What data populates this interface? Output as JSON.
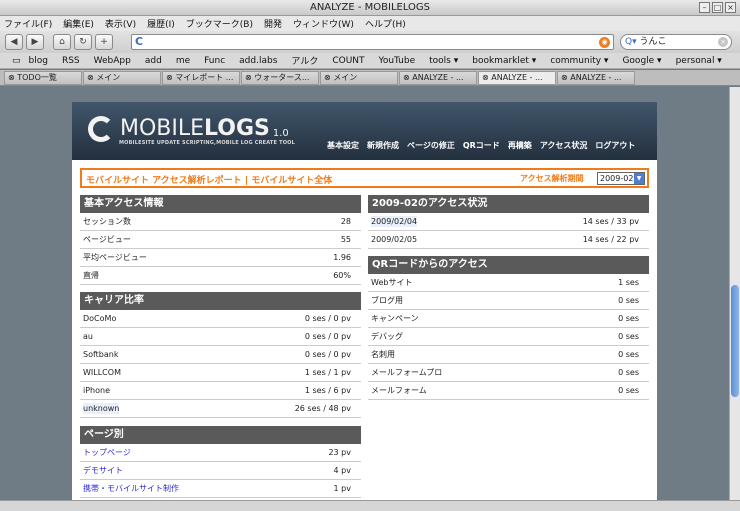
{
  "window": {
    "title": "ANALYZE - MOBILELOGS"
  },
  "menu": [
    "ファイル(F)",
    "編集(E)",
    "表示(V)",
    "履歴(I)",
    "ブックマーク(B)",
    "開発",
    "ウィンドウ(W)",
    "ヘルプ(H)"
  ],
  "search": {
    "value": "うんこ"
  },
  "bookmarks": [
    "blog",
    "RSS",
    "WebApp",
    "add",
    "me",
    "Func",
    "add.labs",
    "アルク",
    "COUNT",
    "YouTube",
    "tools ▾",
    "bookmarklet ▾",
    "community ▾",
    "Google ▾",
    "personal ▾"
  ],
  "tabs": [
    "TODO一覧",
    "メイン",
    "マイレポート ...",
    "ウォータース...",
    "メイン",
    "ANALYZE - ...",
    "ANALYZE - ...",
    "ANALYZE - ..."
  ],
  "site": {
    "logo_main": "MOBILE",
    "logo_bold": "LOGS",
    "logo_version": "1.0",
    "logo_sub": "MOBILESITE UPDATE SCRIPTING,MOBILE LOG CREATE TOOL",
    "nav": [
      "基本設定",
      "新規作成",
      "ページの修正",
      "QRコード",
      "再構築",
      "アクセス状況",
      "ログアウト"
    ]
  },
  "report": {
    "title": "モバイルサイト アクセス解析レポート | モバイルサイト全体",
    "period_label": "アクセス解析期間",
    "period_value": "2009-02"
  },
  "basic": {
    "heading": "基本アクセス情報",
    "rows": [
      {
        "label": "セッション数",
        "value": "28"
      },
      {
        "label": "ページビュー",
        "value": "55"
      },
      {
        "label": "平均ページビュー",
        "value": "1.96"
      },
      {
        "label": "直帰",
        "value": "60%"
      }
    ]
  },
  "carrier": {
    "heading": "キャリア比率",
    "rows": [
      {
        "label": "DoCoMo",
        "value": "0 ses / 0 pv"
      },
      {
        "label": "au",
        "value": "0 ses / 0 pv"
      },
      {
        "label": "Softbank",
        "value": "0 ses / 0 pv"
      },
      {
        "label": "WILLCOM",
        "value": "1 ses / 1 pv"
      },
      {
        "label": "iPhone",
        "value": "1 ses / 6 pv"
      },
      {
        "label": "unknown",
        "value": "26 ses / 48 pv"
      }
    ]
  },
  "pages": {
    "heading": "ページ別",
    "rows": [
      {
        "label": "トップページ",
        "value": "23 pv"
      },
      {
        "label": "デモサイト",
        "value": "4 pv"
      },
      {
        "label": "携帯・モバイルサイト制作",
        "value": "1 pv"
      }
    ]
  },
  "monthly": {
    "heading": "2009-02のアクセス状況",
    "rows": [
      {
        "label": "2009/02/04",
        "value": "14 ses / 33 pv"
      },
      {
        "label": "2009/02/05",
        "value": "14 ses / 22 pv"
      }
    ]
  },
  "qr": {
    "heading": "QRコードからのアクセス",
    "rows": [
      {
        "label": "Webサイト",
        "value": "1 ses"
      },
      {
        "label": "ブログ用",
        "value": "0 ses"
      },
      {
        "label": "キャンペーン",
        "value": "0 ses"
      },
      {
        "label": "デバッグ",
        "value": "0 ses"
      },
      {
        "label": "名刺用",
        "value": "0 ses"
      },
      {
        "label": "メールフォームプロ",
        "value": "0 ses"
      },
      {
        "label": "メールフォーム",
        "value": "0 ses"
      }
    ]
  }
}
